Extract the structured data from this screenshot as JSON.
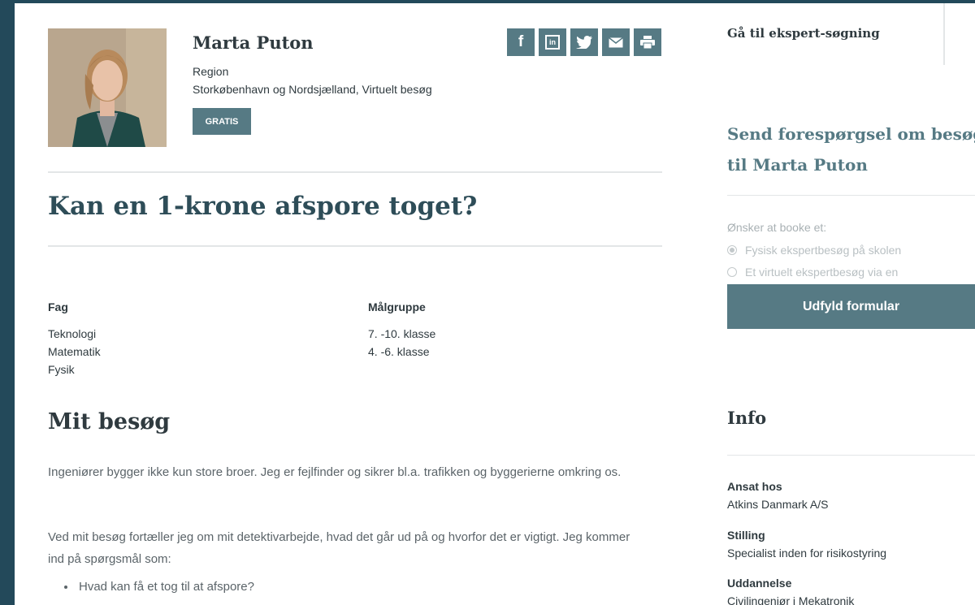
{
  "profile": {
    "name": "Marta Puton",
    "region_label": "Region",
    "region_value": "Storkøbenhavn og Nordsjælland, Virtuelt besøg",
    "badge": "GRATIS"
  },
  "share": {
    "icons": [
      "facebook-icon",
      "linkedin-icon",
      "twitter-icon",
      "mail-icon",
      "print-icon"
    ],
    "facebook": "f",
    "linkedin": "in"
  },
  "article": {
    "title": "Kan en 1-krone afspore toget?",
    "subjects_label": "Fag",
    "subjects": [
      "Teknologi",
      "Matematik",
      "Fysik"
    ],
    "audience_label": "Målgruppe",
    "audience": [
      "7. -10. klasse",
      "4. -6. klasse"
    ],
    "visit_heading": "Mit besøg",
    "paragraph1": "Ingeniører bygger ikke kun store broer. Jeg er fejlfinder og sikrer bl.a. trafikken og byggerierne omkring os.",
    "paragraph2": "Ved mit besøg fortæller jeg om mit detektivarbejde, hvad det går ud på og hvorfor det er vigtigt. Jeg kommer ind på spørgsmål som:",
    "bullet1": "Hvad kan få et tog til at afspore?"
  },
  "sidebar": {
    "search_link": "Gå til ekspert-søgning",
    "request_title_line1": "Send forespørgsel om besøg",
    "request_title_line2": "til Marta Puton",
    "wish_label": "Ønsker at booke et:",
    "option1": "Fysisk ekspertbesøg på skolen",
    "option2": "Et virtuelt ekspertbesøg via en",
    "selected_option": "Fysisk ekspertbesøg på skolen",
    "cta": "Udfyld formular",
    "info_title": "Info",
    "employer_label": "Ansat hos",
    "employer_value": "Atkins Danmark A/S",
    "position_label": "Stilling",
    "position_value": "Specialist inden for risikostyring",
    "education_label": "Uddannelse",
    "education_value": "Civilingeniør i Mekatronik"
  },
  "colors": {
    "accent": "#567a84",
    "frame": "#23495a",
    "heading": "#2e4d58",
    "text": "#2f3a3f"
  }
}
